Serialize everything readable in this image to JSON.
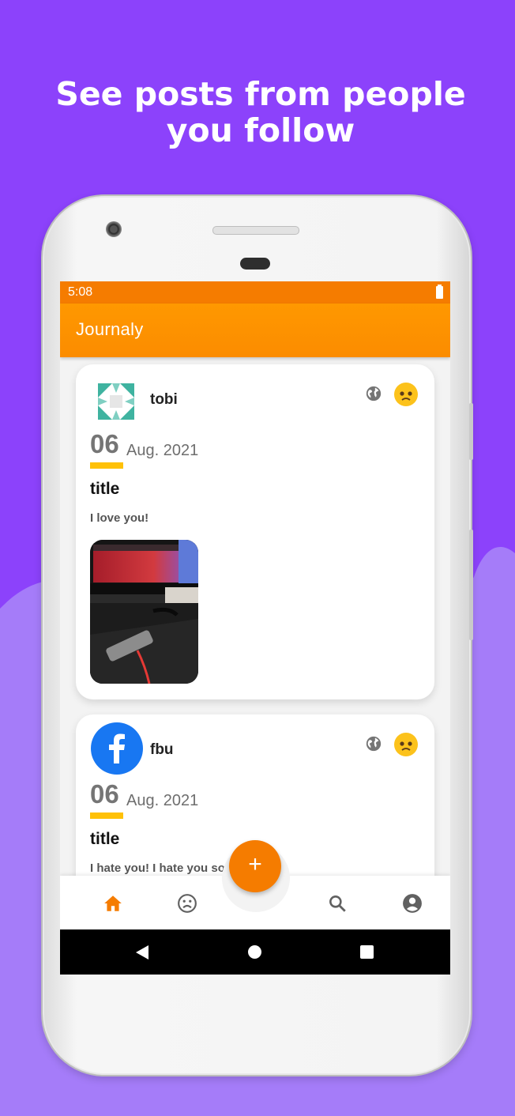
{
  "headline": {
    "line1": "See posts from people",
    "line2": "you follow"
  },
  "colors": {
    "background_top": "#8c42fb",
    "background_bottom": "#a57cf9",
    "accent": "#f57c00",
    "date_underline": "#ffc107"
  },
  "status_bar": {
    "time": "5:08"
  },
  "app_bar": {
    "title": "Journaly"
  },
  "posts": [
    {
      "username": "tobi",
      "day": "06",
      "month_year": "Aug. 2021",
      "title": "title",
      "body": "I love you!",
      "visibility_icon": "globe-icon",
      "mood_icon": "sad-face-emoji-icon",
      "has_photo": true
    },
    {
      "username": "fbu",
      "day": "06",
      "month_year": "Aug. 2021",
      "title": "title",
      "body": "I hate you! I hate you so",
      "visibility_icon": "globe-icon",
      "mood_icon": "sad-face-emoji-icon",
      "has_photo": false
    }
  ],
  "fab": {
    "label": "+"
  },
  "bottom_nav": {
    "items": [
      "home-icon",
      "sad-face-icon",
      "search-icon",
      "account-icon"
    ],
    "active": "home-icon"
  }
}
